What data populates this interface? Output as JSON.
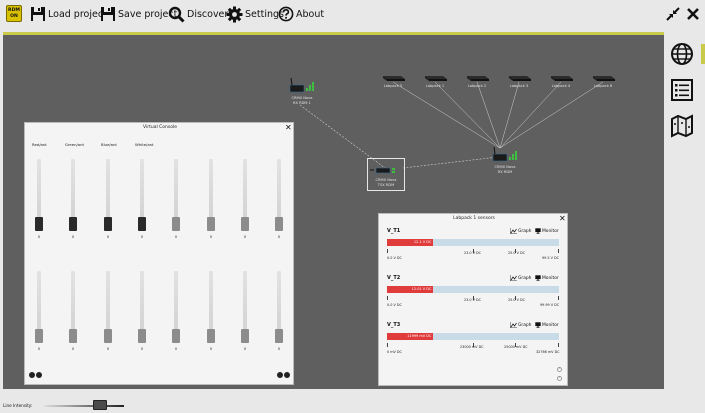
{
  "toolbar": {
    "logo_line1": "RDM",
    "logo_line2": "ON",
    "load_label": "Load project",
    "save_label": "Save project",
    "discovery_label": "Discovery",
    "settings_label": "Settings",
    "about_label": "About"
  },
  "colors": {
    "canvas_bg": "#5f5f5f",
    "accent": "#c9c94a",
    "sensor_fill": "#e03c3c",
    "sensor_track": "#c8dbe6"
  },
  "nodes": [
    {
      "id": "rdm1",
      "label1": "CRMX Nova",
      "label2": "RX RDM 1",
      "kind": "wireless"
    },
    {
      "id": "tsx",
      "label1": "CRMX Nova",
      "label2": "TSX RDM",
      "kind": "transmitter"
    },
    {
      "id": "rx",
      "label1": "CRMX Nova",
      "label2": "RX RDM",
      "kind": "wireless"
    },
    {
      "id": "lp5",
      "label1": "Labpack 5",
      "kind": "labpack"
    },
    {
      "id": "lp1",
      "label1": "Labpack 1",
      "kind": "labpack"
    },
    {
      "id": "lp2",
      "label1": "Labpack 2",
      "kind": "labpack"
    },
    {
      "id": "lp3",
      "label1": "Labpack 3",
      "kind": "labpack"
    },
    {
      "id": "lp4",
      "label1": "Labpack 4",
      "kind": "labpack"
    },
    {
      "id": "lp6",
      "label1": "Labpack 6",
      "kind": "labpack"
    }
  ],
  "sidebar": {
    "items": [
      {
        "icon": "globe-icon"
      },
      {
        "icon": "list-icon"
      },
      {
        "icon": "map-icon"
      }
    ]
  },
  "virtual_console": {
    "title": "Virtual Console",
    "channel_labels": [
      "Red/ant",
      "Green/ant",
      "Blue/ant",
      "White/ant"
    ],
    "row1": [
      "0",
      "0",
      "0",
      "0",
      "0",
      "0",
      "0",
      "0"
    ],
    "row2": [
      "0",
      "0",
      "0",
      "0",
      "0",
      "0",
      "0",
      "0"
    ]
  },
  "labpack": {
    "title": "Labpack 1 sensors",
    "graph_label": "Graph",
    "monitor_label": "Monitor",
    "sensors": [
      {
        "name": "V_T1",
        "value": "12.1 V DC",
        "fraction": 0.27,
        "min": "0.0 V DC",
        "t1": "23.0 V DC",
        "t2": "25.0 V DC",
        "max": "99.5 V DC"
      },
      {
        "name": "V_T2",
        "value": "12.01 V DC",
        "fraction": 0.27,
        "min": "0.0 V DC",
        "t1": "23.0 V DC",
        "t2": "25.0 V DC",
        "max": "99.99 V DC"
      },
      {
        "name": "V_T3",
        "value": "11999 mV DC",
        "fraction": 0.27,
        "min": "0 mV DC",
        "t1": "23000 mV DC",
        "t2": "25000 mV DC",
        "max": "32766 mV DC"
      }
    ]
  },
  "line_intensity": {
    "label": "Line Intensity:",
    "level": 0.7
  }
}
